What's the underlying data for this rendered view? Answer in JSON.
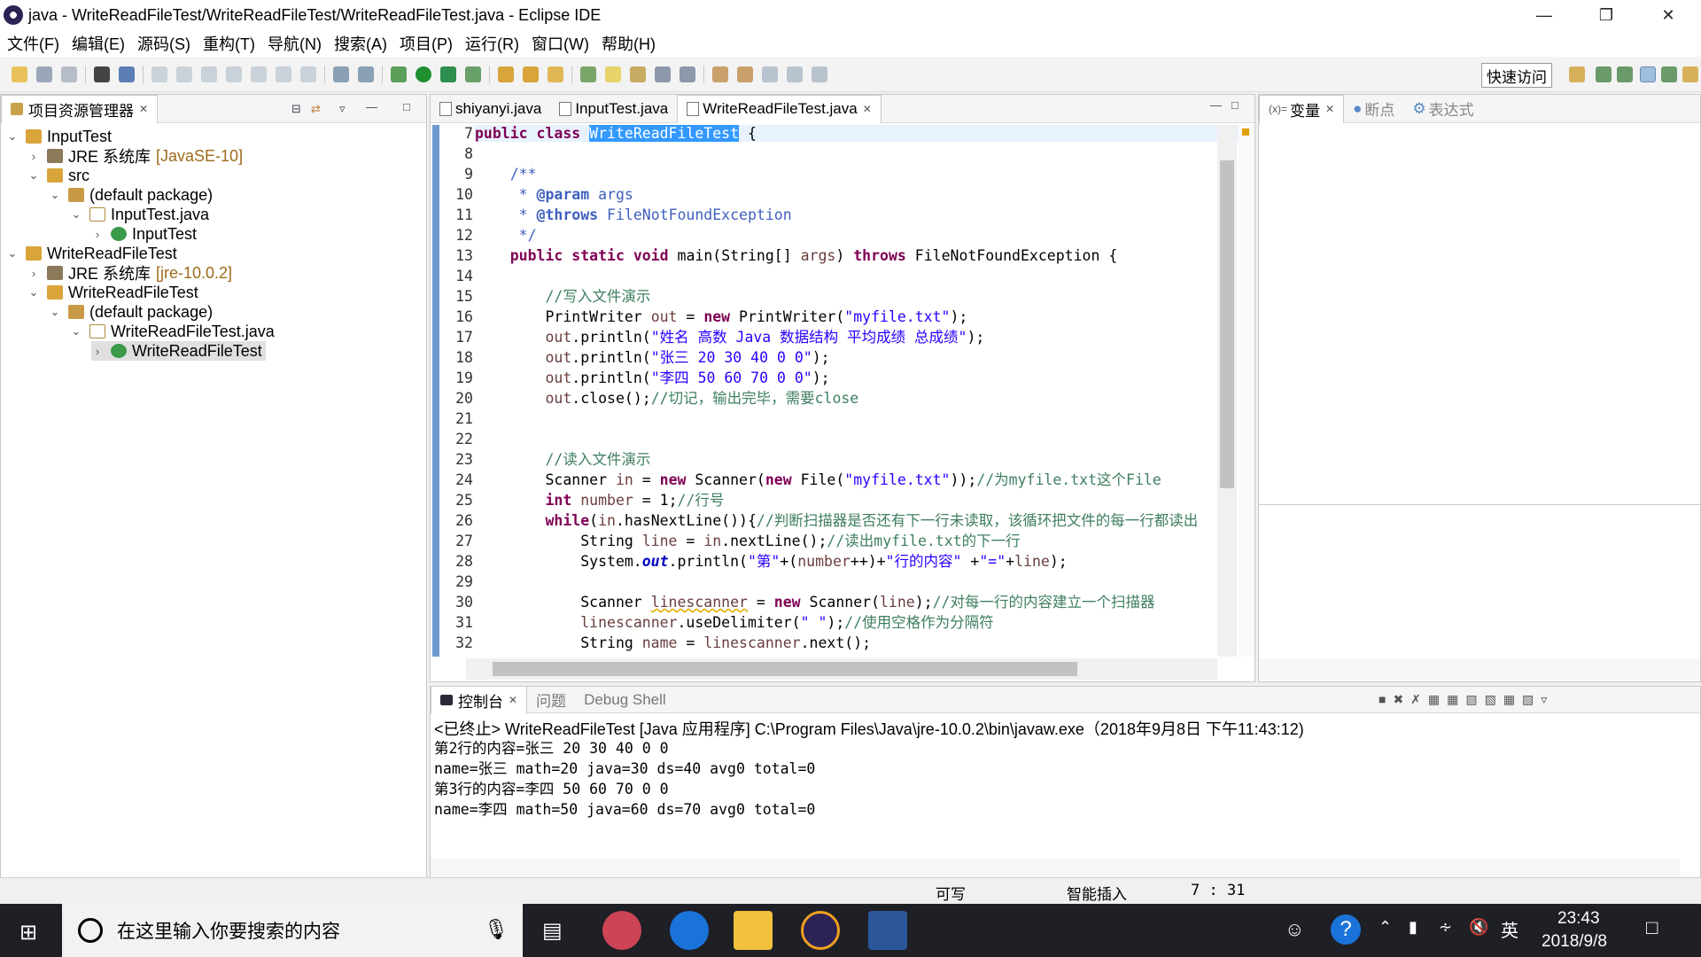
{
  "window": {
    "title": "java - WriteReadFileTest/WriteReadFileTest/WriteReadFileTest.java - Eclipse IDE"
  },
  "menu": [
    "文件(F)",
    "编辑(E)",
    "源码(S)",
    "重构(T)",
    "导航(N)",
    "搜索(A)",
    "项目(P)",
    "运行(R)",
    "窗口(W)",
    "帮助(H)"
  ],
  "toolbar": {
    "quick_access": "快速访问"
  },
  "explorer": {
    "title": "项目资源管理器",
    "rows": [
      {
        "label": "InputTest",
        "version": ""
      },
      {
        "label": "JRE 系统库",
        "version": "[JavaSE-10]"
      },
      {
        "label": "src",
        "version": ""
      },
      {
        "label": "(default package)",
        "version": ""
      },
      {
        "label": "InputTest.java",
        "version": ""
      },
      {
        "label": "InputTest",
        "version": ""
      },
      {
        "label": "WriteReadFileTest",
        "version": ""
      },
      {
        "label": "JRE 系统库",
        "version": "[jre-10.0.2]"
      },
      {
        "label": "WriteReadFileTest",
        "version": ""
      },
      {
        "label": "(default package)",
        "version": ""
      },
      {
        "label": "WriteReadFileTest.java",
        "version": ""
      },
      {
        "label": "WriteReadFileTest",
        "version": ""
      }
    ]
  },
  "editor": {
    "tabs": [
      "shiyanyi.java",
      "InputTest.java",
      "WriteReadFileTest.java"
    ],
    "line_numbers": [
      "7",
      "8",
      "9",
      "10",
      "11",
      "12",
      "13",
      "14",
      "15",
      "16",
      "17",
      "18",
      "19",
      "20",
      "21",
      "22",
      "23",
      "24",
      "25",
      "26",
      "27",
      "28",
      "29",
      "30",
      "31",
      "32"
    ]
  },
  "right_panel": {
    "tabs": [
      "变量",
      "断点",
      "表达式"
    ]
  },
  "console": {
    "tabs": [
      "控制台",
      "问题",
      "Debug Shell"
    ],
    "header": "<已终止> WriteReadFileTest [Java 应用程序] C:\\Program Files\\Java\\jre-10.0.2\\bin\\javaw.exe（2018年9月8日 下午11:43:12)",
    "lines": [
      "第2行的内容=张三 20 30 40 0 0",
      "name=张三 math=20 java=30 ds=40 avg0 total=0",
      "第3行的内容=李四 50 60 70 0 0",
      "name=李四 math=50 java=60 ds=70 avg0 total=0"
    ]
  },
  "status": {
    "writable": "可写",
    "insert_mode": "智能插入",
    "position": "7 : 31"
  },
  "taskbar": {
    "search_placeholder": "在这里输入你要搜索的内容",
    "time": "23:43",
    "date": "2018/9/8",
    "ime": "英"
  }
}
